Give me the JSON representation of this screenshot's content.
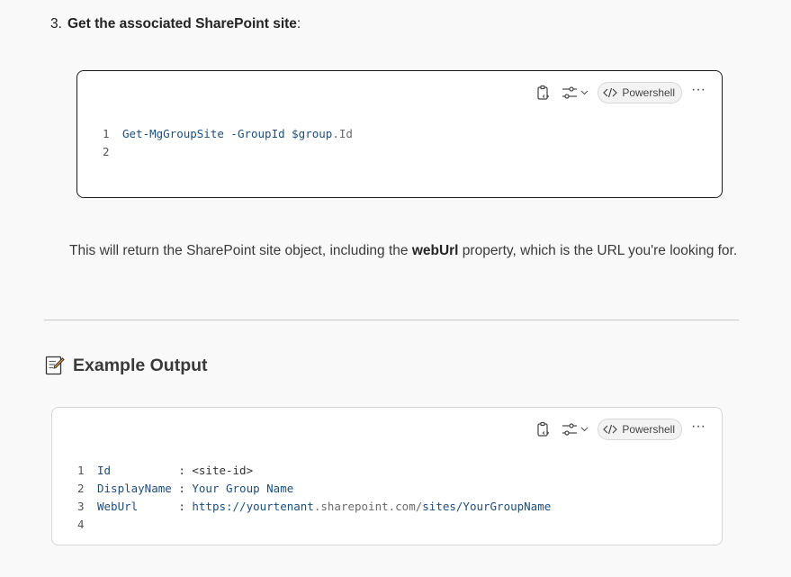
{
  "step": {
    "number": "3.",
    "title": "Get the associated SharePoint site",
    "suffix": ":"
  },
  "code_block_1": {
    "language": "Powershell",
    "lines": [
      {
        "num": "1",
        "cmd": "Get-MgGroupSite",
        "param": " -GroupId ",
        "var": "$group",
        "prop": ".Id"
      },
      {
        "num": "2"
      }
    ]
  },
  "paragraph": {
    "before": "This will return the SharePoint site object, including the ",
    "bold": "webUrl",
    "after": " property, which is the URL you're looking for."
  },
  "section_heading": {
    "icon": "memo-icon",
    "text": "Example Output"
  },
  "code_block_2": {
    "language": "Powershell",
    "lines": [
      {
        "num": "1",
        "key": "Id          ",
        "sep": ": ",
        "value": "<site-id>"
      },
      {
        "num": "2",
        "key": "DisplayName ",
        "sep": ": ",
        "value": "Your Group Name"
      },
      {
        "num": "3",
        "key": "WebUrl      ",
        "sep": ": ",
        "url_a": "https://yourtenant",
        "url_b": ".sharepoint.com/",
        "url_c": "sites/YourGroupName"
      },
      {
        "num": "4"
      }
    ]
  },
  "toolbar": {
    "copy_icon": "clipboard-code-icon",
    "settings_icon": "sliders-icon",
    "more_label": "···"
  }
}
